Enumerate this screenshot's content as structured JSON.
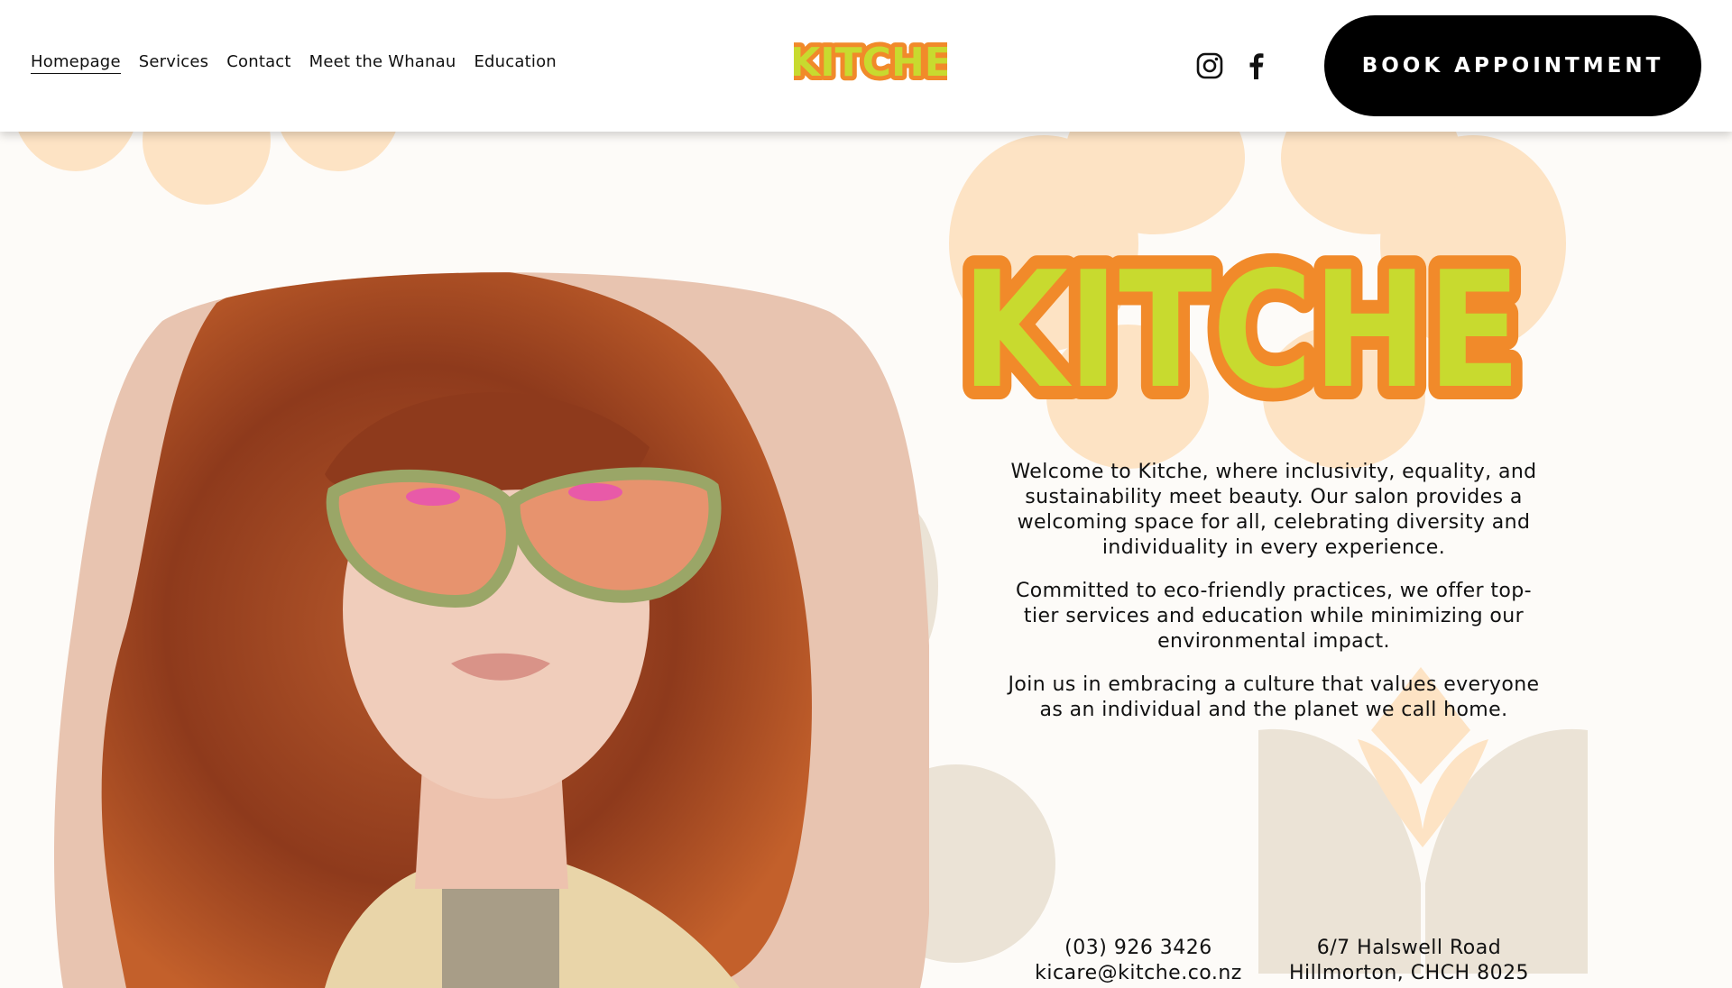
{
  "header": {
    "nav": [
      {
        "label": "Homepage",
        "active": true
      },
      {
        "label": "Services",
        "active": false
      },
      {
        "label": "Contact",
        "active": false
      },
      {
        "label": "Meet the Whanau",
        "active": false
      },
      {
        "label": "Education",
        "active": false
      }
    ],
    "logo_text": "KITCHE",
    "social": [
      "instagram-icon",
      "facebook-icon"
    ],
    "book_label": "BOOK APPOINTMENT"
  },
  "hero": {
    "logo_text": "KITCHE",
    "paragraphs": [
      "Welcome to Kitche, where inclusivity, equality, and sustainability meet beauty. Our salon provides a welcoming space for all, celebrating diversity and individuality in every experience.",
      "Committed to eco-friendly practices, we offer top-tier services and education while minimizing our environmental impact.",
      "Join us in embracing a culture that values everyone as an individual and the planet we call home."
    ]
  },
  "contact": {
    "phone": "(03) 926 3426",
    "email": "kicare@kitche.co.nz",
    "address_line1": "6/7 Halswell Road",
    "address_line2": "Hillmorton, CHCH 8025"
  },
  "colors": {
    "logo_fill": "#c8da2f",
    "logo_outline": "#f18a2a",
    "peach": "#fde3c4",
    "beige": "#ebe3d6",
    "button": "#000000"
  }
}
